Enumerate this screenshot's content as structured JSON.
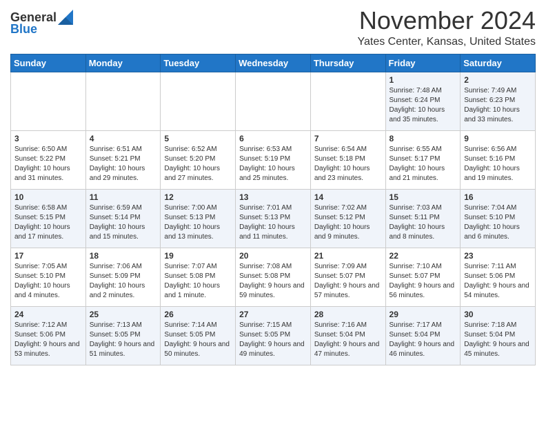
{
  "header": {
    "logo_general": "General",
    "logo_blue": "Blue",
    "month_title": "November 2024",
    "location": "Yates Center, Kansas, United States"
  },
  "weekdays": [
    "Sunday",
    "Monday",
    "Tuesday",
    "Wednesday",
    "Thursday",
    "Friday",
    "Saturday"
  ],
  "weeks": [
    [
      {
        "day": "",
        "content": ""
      },
      {
        "day": "",
        "content": ""
      },
      {
        "day": "",
        "content": ""
      },
      {
        "day": "",
        "content": ""
      },
      {
        "day": "",
        "content": ""
      },
      {
        "day": "1",
        "content": "Sunrise: 7:48 AM\nSunset: 6:24 PM\nDaylight: 10 hours and 35 minutes."
      },
      {
        "day": "2",
        "content": "Sunrise: 7:49 AM\nSunset: 6:23 PM\nDaylight: 10 hours and 33 minutes."
      }
    ],
    [
      {
        "day": "3",
        "content": "Sunrise: 6:50 AM\nSunset: 5:22 PM\nDaylight: 10 hours and 31 minutes."
      },
      {
        "day": "4",
        "content": "Sunrise: 6:51 AM\nSunset: 5:21 PM\nDaylight: 10 hours and 29 minutes."
      },
      {
        "day": "5",
        "content": "Sunrise: 6:52 AM\nSunset: 5:20 PM\nDaylight: 10 hours and 27 minutes."
      },
      {
        "day": "6",
        "content": "Sunrise: 6:53 AM\nSunset: 5:19 PM\nDaylight: 10 hours and 25 minutes."
      },
      {
        "day": "7",
        "content": "Sunrise: 6:54 AM\nSunset: 5:18 PM\nDaylight: 10 hours and 23 minutes."
      },
      {
        "day": "8",
        "content": "Sunrise: 6:55 AM\nSunset: 5:17 PM\nDaylight: 10 hours and 21 minutes."
      },
      {
        "day": "9",
        "content": "Sunrise: 6:56 AM\nSunset: 5:16 PM\nDaylight: 10 hours and 19 minutes."
      }
    ],
    [
      {
        "day": "10",
        "content": "Sunrise: 6:58 AM\nSunset: 5:15 PM\nDaylight: 10 hours and 17 minutes."
      },
      {
        "day": "11",
        "content": "Sunrise: 6:59 AM\nSunset: 5:14 PM\nDaylight: 10 hours and 15 minutes."
      },
      {
        "day": "12",
        "content": "Sunrise: 7:00 AM\nSunset: 5:13 PM\nDaylight: 10 hours and 13 minutes."
      },
      {
        "day": "13",
        "content": "Sunrise: 7:01 AM\nSunset: 5:13 PM\nDaylight: 10 hours and 11 minutes."
      },
      {
        "day": "14",
        "content": "Sunrise: 7:02 AM\nSunset: 5:12 PM\nDaylight: 10 hours and 9 minutes."
      },
      {
        "day": "15",
        "content": "Sunrise: 7:03 AM\nSunset: 5:11 PM\nDaylight: 10 hours and 8 minutes."
      },
      {
        "day": "16",
        "content": "Sunrise: 7:04 AM\nSunset: 5:10 PM\nDaylight: 10 hours and 6 minutes."
      }
    ],
    [
      {
        "day": "17",
        "content": "Sunrise: 7:05 AM\nSunset: 5:10 PM\nDaylight: 10 hours and 4 minutes."
      },
      {
        "day": "18",
        "content": "Sunrise: 7:06 AM\nSunset: 5:09 PM\nDaylight: 10 hours and 2 minutes."
      },
      {
        "day": "19",
        "content": "Sunrise: 7:07 AM\nSunset: 5:08 PM\nDaylight: 10 hours and 1 minute."
      },
      {
        "day": "20",
        "content": "Sunrise: 7:08 AM\nSunset: 5:08 PM\nDaylight: 9 hours and 59 minutes."
      },
      {
        "day": "21",
        "content": "Sunrise: 7:09 AM\nSunset: 5:07 PM\nDaylight: 9 hours and 57 minutes."
      },
      {
        "day": "22",
        "content": "Sunrise: 7:10 AM\nSunset: 5:07 PM\nDaylight: 9 hours and 56 minutes."
      },
      {
        "day": "23",
        "content": "Sunrise: 7:11 AM\nSunset: 5:06 PM\nDaylight: 9 hours and 54 minutes."
      }
    ],
    [
      {
        "day": "24",
        "content": "Sunrise: 7:12 AM\nSunset: 5:06 PM\nDaylight: 9 hours and 53 minutes."
      },
      {
        "day": "25",
        "content": "Sunrise: 7:13 AM\nSunset: 5:05 PM\nDaylight: 9 hours and 51 minutes."
      },
      {
        "day": "26",
        "content": "Sunrise: 7:14 AM\nSunset: 5:05 PM\nDaylight: 9 hours and 50 minutes."
      },
      {
        "day": "27",
        "content": "Sunrise: 7:15 AM\nSunset: 5:05 PM\nDaylight: 9 hours and 49 minutes."
      },
      {
        "day": "28",
        "content": "Sunrise: 7:16 AM\nSunset: 5:04 PM\nDaylight: 9 hours and 47 minutes."
      },
      {
        "day": "29",
        "content": "Sunrise: 7:17 AM\nSunset: 5:04 PM\nDaylight: 9 hours and 46 minutes."
      },
      {
        "day": "30",
        "content": "Sunrise: 7:18 AM\nSunset: 5:04 PM\nDaylight: 9 hours and 45 minutes."
      }
    ]
  ]
}
